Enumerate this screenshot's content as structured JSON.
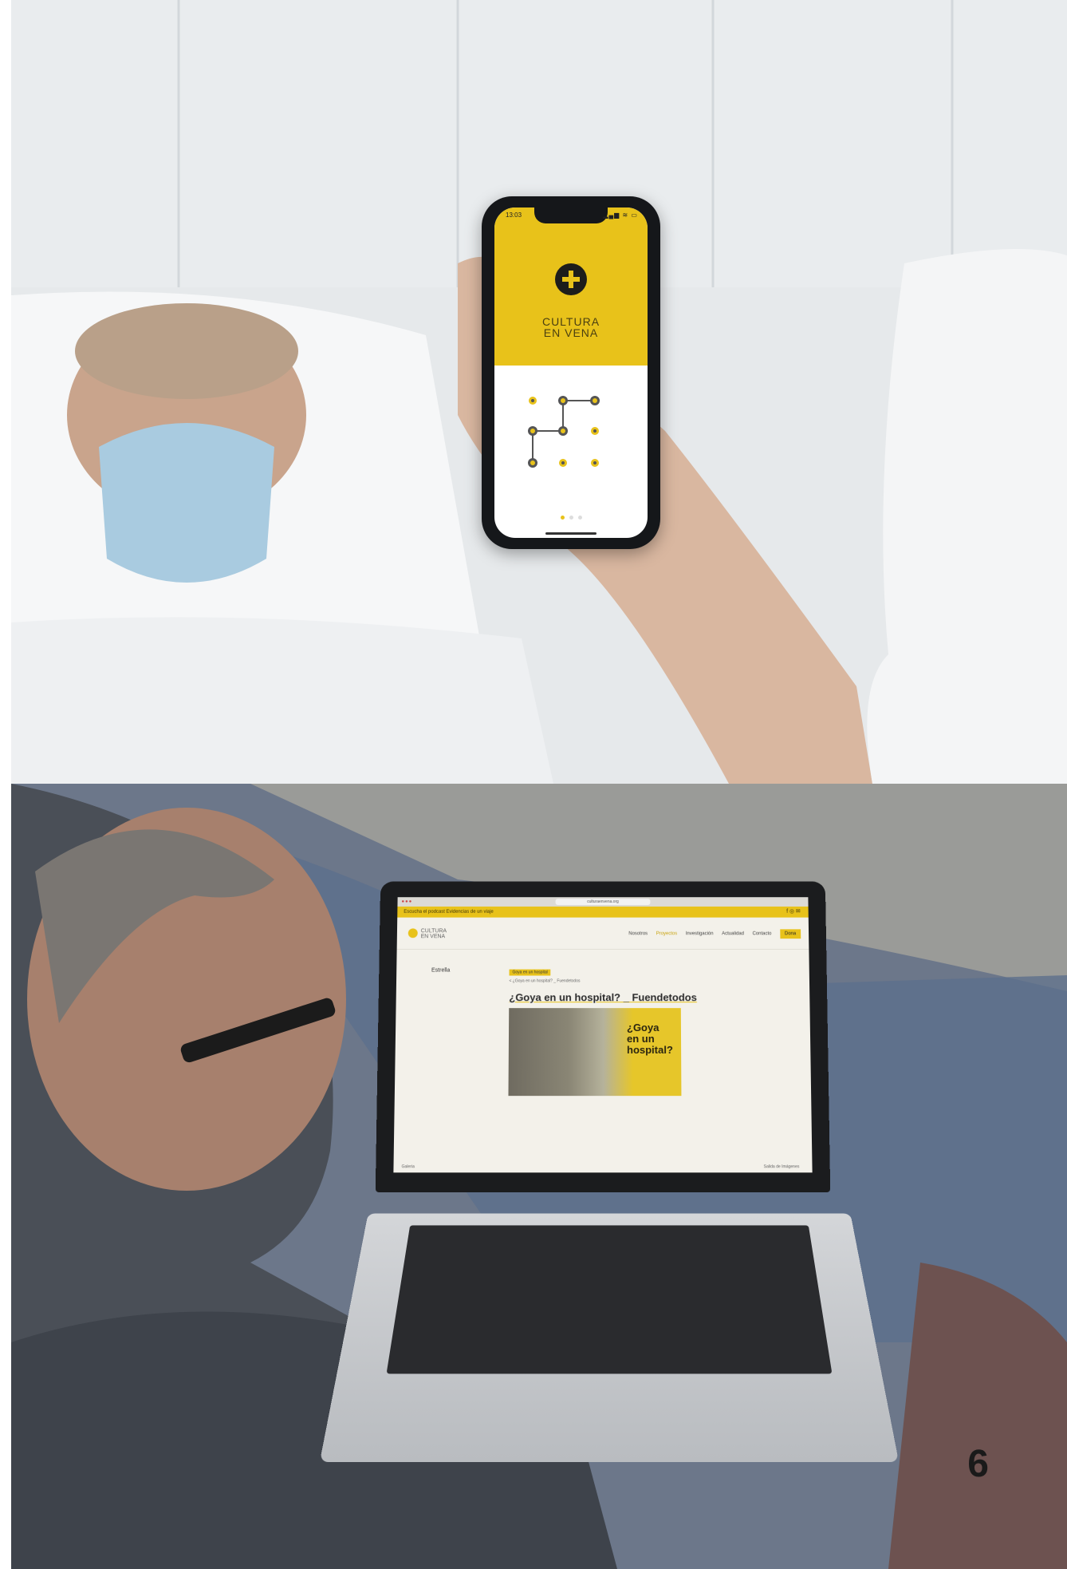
{
  "phone": {
    "status_time": "13:03",
    "status_icons": "▂▄▆ ≋ ▭",
    "app_name": "CULTURA\nEN VENA",
    "logo_icon": "plus-circle-icon",
    "pattern_dots": 9,
    "page_indicator": {
      "count": 3,
      "active": 0
    }
  },
  "laptop": {
    "url": "culturaenvena.org",
    "promo_text": "Escucha el podcast Evidencias de un viaje",
    "site_logo": "CULTURA\nEN VENA",
    "nav": [
      "Nosotros",
      "Proyectos",
      "Investigación",
      "Actualidad",
      "Contacto",
      "Dona"
    ],
    "side_label": "Estrella",
    "tag": "Goya en un hospital",
    "breadcrumb": "< ¿Goya en un hospital? _ Fuendetodos",
    "article_title": "¿Goya en un hospital? _ Fuendetodos",
    "hero_text": "¿Goya\nen un\nhospital?",
    "footer_left": "Galeria",
    "footer_right": "Salida de Imágenes"
  },
  "page_number": "6",
  "colors": {
    "brand_yellow": "#e8c21a",
    "ink": "#1d1d1b"
  }
}
